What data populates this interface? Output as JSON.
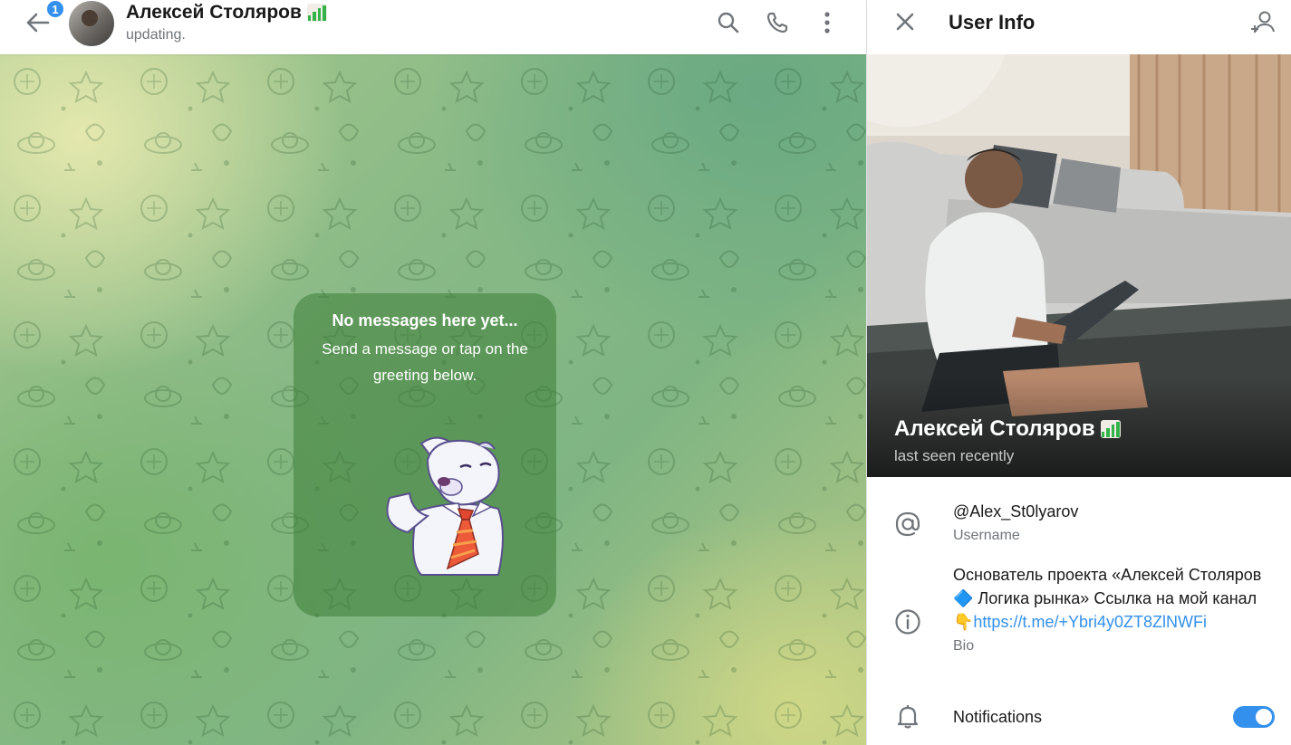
{
  "chat": {
    "back_badge": "1",
    "title": "Алексей Столяров",
    "status": "updating.",
    "empty": {
      "title": "No messages here yet...",
      "subtitle": "Send a message or tap on the greeting below."
    }
  },
  "icons": {
    "back": "arrow-left-icon",
    "search": "search-icon",
    "call": "phone-icon",
    "more": "more-vertical-icon",
    "close": "close-icon",
    "add_contact": "add-user-icon",
    "username": "at-sign-icon",
    "bio": "info-icon",
    "notifications": "bell-icon",
    "name_emoji": "chart-bars-icon"
  },
  "panel": {
    "title": "User Info",
    "name": "Алексей Столяров",
    "last_seen": "last seen recently",
    "username": "@Alex_St0lyarov",
    "username_label": "Username",
    "bio_text": "Основатель проекта «Алексей Столяров 🔷 Логика рынка» Ссылка на мой канал 👇",
    "bio_link": "https://t.me/+Ybri4y0ZT8ZlNWFi",
    "bio_label": "Bio",
    "notifications_label": "Notifications",
    "notifications_on": true
  },
  "colors": {
    "accent": "#3390ec",
    "text_primary": "#1a1a1a",
    "text_secondary": "#707579"
  }
}
